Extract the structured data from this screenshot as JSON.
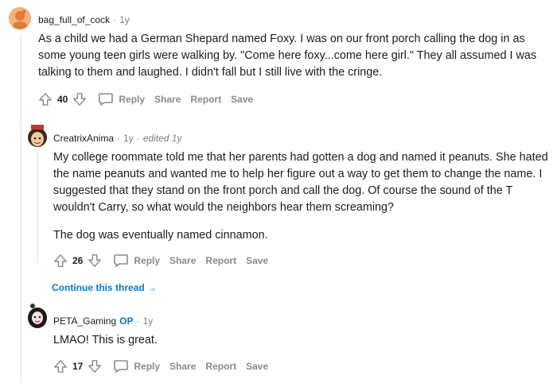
{
  "comments": [
    {
      "username": "bag_full_of_cock",
      "age": "1y",
      "paragraphs": [
        "As a child we had a German Shepard named Foxy. I was on our front porch calling the dog in as some young teen girls were walking by. \"Come here foxy...come here girl.\" They all assumed I was talking to them and laughed. I didn't fall but I still live with the cringe."
      ],
      "votes": "40"
    },
    {
      "username": "CreatrixAnima",
      "age": "1y",
      "edited": "edited 1y",
      "paragraphs": [
        "My college roommate told me that her parents had gotten a dog and named it peanuts. She hated the name peanuts and wanted me to help her figure out a way to get them to change the name. I suggested that they stand on the front porch and call the dog. Of course the sound of the T wouldn't Carry, so what would the neighbors hear them screaming?",
        "The dog was eventually named cinnamon."
      ],
      "votes": "26"
    },
    {
      "username": "PETA_Gaming",
      "op_badge": "OP",
      "age": "1y",
      "paragraphs": [
        "LMAO! This is great."
      ],
      "votes": "17"
    }
  ],
  "actions": {
    "reply": "Reply",
    "share": "Share",
    "report": "Report",
    "save": "Save"
  },
  "continue_thread": "Continue this thread →",
  "separator": "·",
  "colors": {
    "accent": "#0079d3",
    "muted": "#878a8c",
    "text": "#1c1c1c"
  }
}
